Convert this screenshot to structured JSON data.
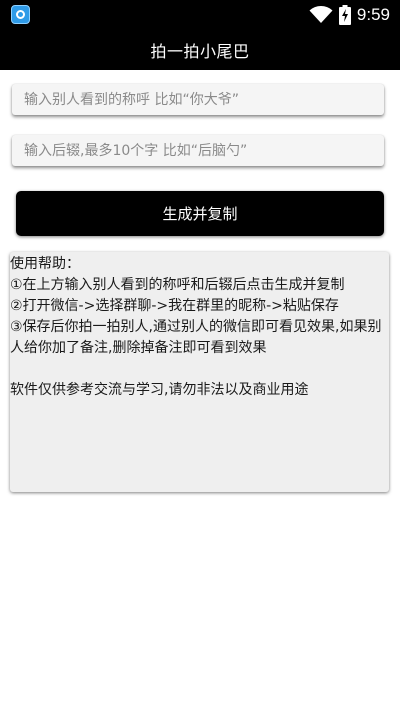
{
  "status_bar": {
    "time": "9:59",
    "icons": [
      "wifi-icon",
      "battery-charging-icon"
    ]
  },
  "header": {
    "title": "拍一拍小尾巴"
  },
  "form": {
    "name_input": {
      "value": "",
      "placeholder": "输入别人看到的称呼 比如“你大爷”"
    },
    "suffix_input": {
      "value": "",
      "placeholder": "输入后辍,最多10个字 比如“后脑勺”"
    },
    "generate_button_label": "生成并复制"
  },
  "help": {
    "title": " 使用帮助：",
    "step1": "  ①在上方输入别人看到的称呼和后辍后点击生成并复制",
    "step2": "  ②打开微信->选择群聊->我在群里的昵称->粘贴保存",
    "step3": "  ③保存后你拍一拍别人,通过别人的微信即可看见效果,如果别人给你加了备注,删除掉备注即可看到效果",
    "disclaimer": "软件仅供参考交流与学习,请勿非法以及商业用途"
  }
}
